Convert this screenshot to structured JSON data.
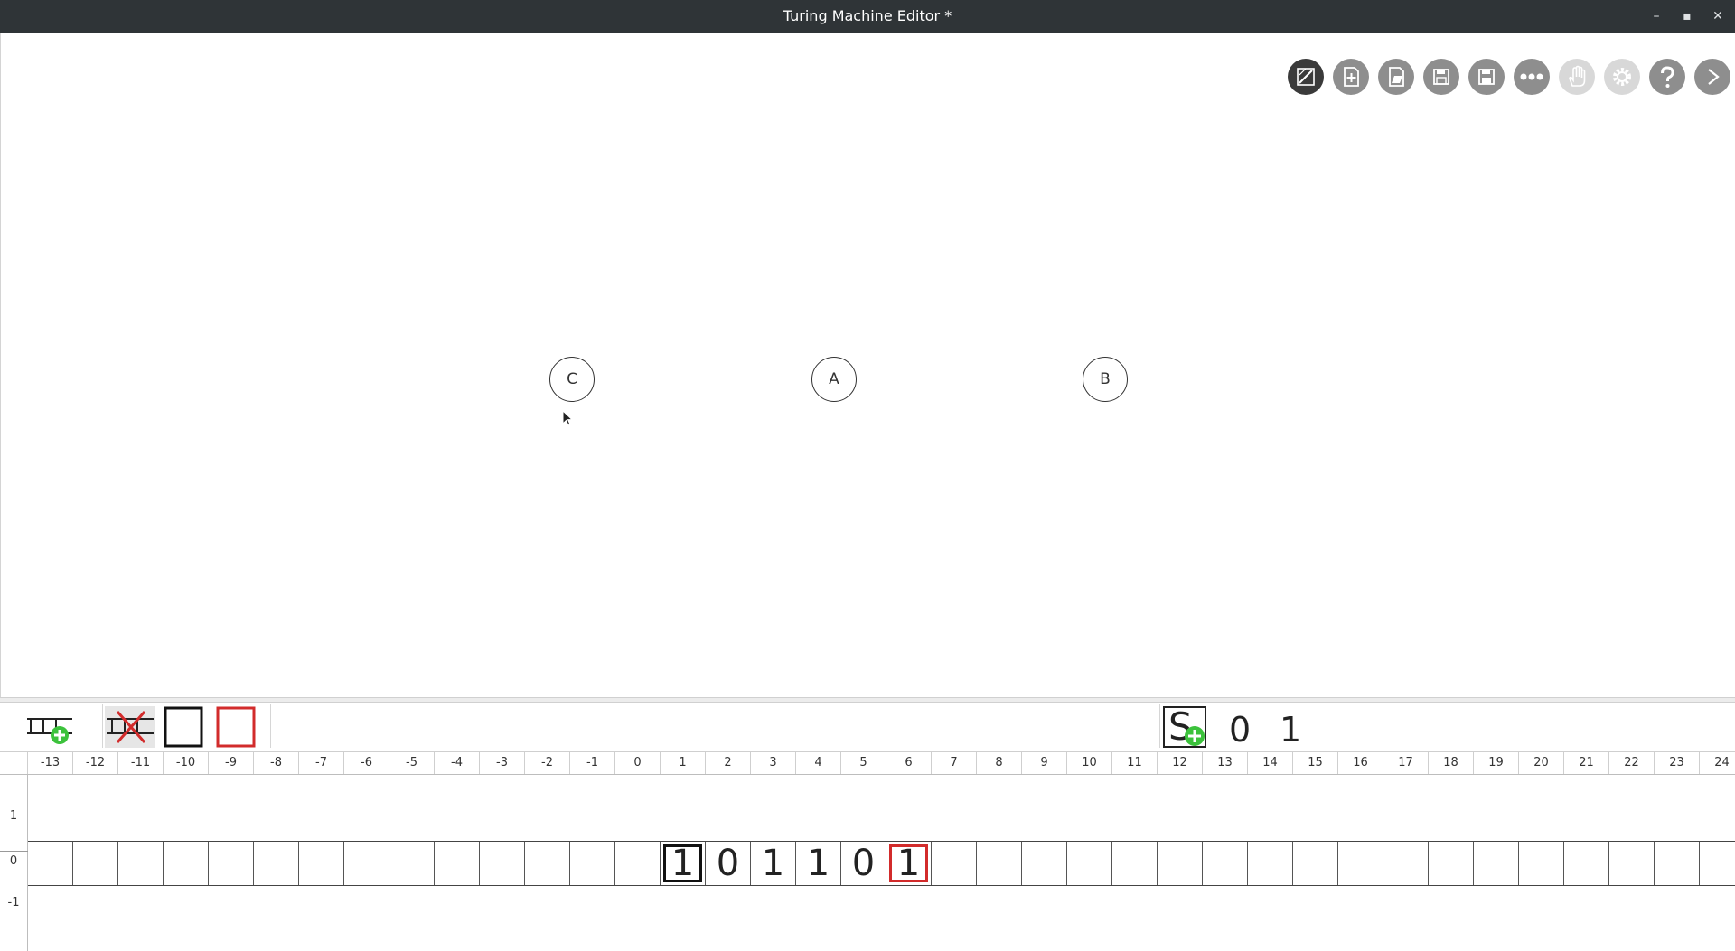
{
  "window": {
    "title": "Turing Machine Editor *",
    "controls": {
      "minimize": "–",
      "maximize": "▪",
      "close": "✕"
    }
  },
  "toolbar": {
    "buttons": [
      {
        "name": "edit-mode-icon",
        "active": true
      },
      {
        "name": "new-file-icon"
      },
      {
        "name": "open-file-icon"
      },
      {
        "name": "save-icon"
      },
      {
        "name": "save-as-icon"
      },
      {
        "name": "more-icon"
      },
      {
        "name": "hand-pan-icon",
        "disabled": true
      },
      {
        "name": "settings-gear-icon",
        "disabled": true
      },
      {
        "name": "help-icon"
      },
      {
        "name": "run-forward-icon"
      }
    ]
  },
  "states": [
    {
      "label": "C"
    },
    {
      "label": "A"
    },
    {
      "label": "B"
    }
  ],
  "alphabet": {
    "symbols": [
      "0",
      "1"
    ],
    "add_symbol_label": "S"
  },
  "ruler": {
    "columns": [
      "-13",
      "-12",
      "-11",
      "-10",
      "-9",
      "-8",
      "-7",
      "-6",
      "-5",
      "-4",
      "-3",
      "-2",
      "-1",
      "0",
      "1",
      "2",
      "3",
      "4",
      "5",
      "6",
      "7",
      "8",
      "9",
      "10",
      "11",
      "12",
      "13",
      "14",
      "15",
      "16",
      "17",
      "18",
      "19",
      "20",
      "21",
      "22",
      "23",
      "24"
    ]
  },
  "rows": {
    "labels": [
      "1",
      "0",
      "-1"
    ]
  },
  "tape": {
    "cells": [
      {
        "col": "1",
        "value": "1",
        "marker": "head-black"
      },
      {
        "col": "2",
        "value": "0"
      },
      {
        "col": "3",
        "value": "1"
      },
      {
        "col": "4",
        "value": "1"
      },
      {
        "col": "5",
        "value": "0"
      },
      {
        "col": "6",
        "value": "1",
        "marker": "end-red"
      }
    ]
  },
  "colors": {
    "accent_red": "#d22b2b",
    "add_green": "#3cc23c",
    "titlebar": "#2f3437"
  }
}
